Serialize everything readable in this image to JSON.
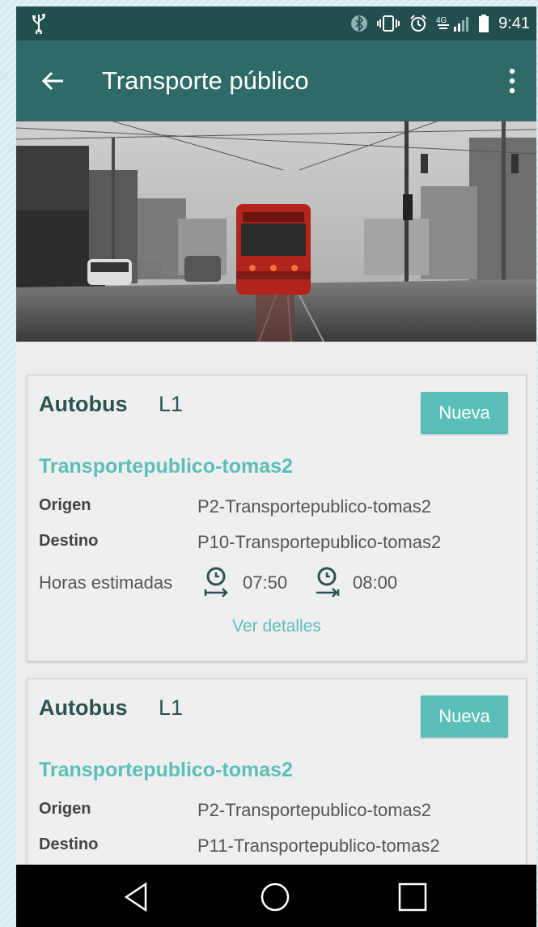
{
  "status_bar": {
    "time": "9:41",
    "icons": [
      "usb-icon",
      "bluetooth-icon",
      "vibrate-icon",
      "alarm-icon",
      "4g-signal-icon",
      "battery-icon"
    ]
  },
  "app_bar": {
    "title": "Transporte público",
    "back_icon": "arrow-back-icon",
    "menu_icon": "more-vert-icon"
  },
  "colors": {
    "status_bar": "#204f4d",
    "app_bar": "#2e6b68",
    "accent": "#5bbfb9",
    "card_title": "#2b5452"
  },
  "cards": [
    {
      "type": "Autobus",
      "line": "L1",
      "badge": "Nueva",
      "organization": "Transportepublico-tomas2",
      "origin_label": "Origen",
      "origin": "P2-Transportepublico-tomas2",
      "destination_label": "Destino",
      "destination": "P10-Transportepublico-tomas2",
      "times_label": "Horas estimadas",
      "departure": "07:50",
      "arrival": "08:00",
      "details_link": "Ver detalles"
    },
    {
      "type": "Autobus",
      "line": "L1",
      "badge": "Nueva",
      "organization": "Transportepublico-tomas2",
      "origin_label": "Origen",
      "origin": "P2-Transportepublico-tomas2",
      "destination_label": "Destino",
      "destination": "P11-Transportepublico-tomas2"
    }
  ]
}
